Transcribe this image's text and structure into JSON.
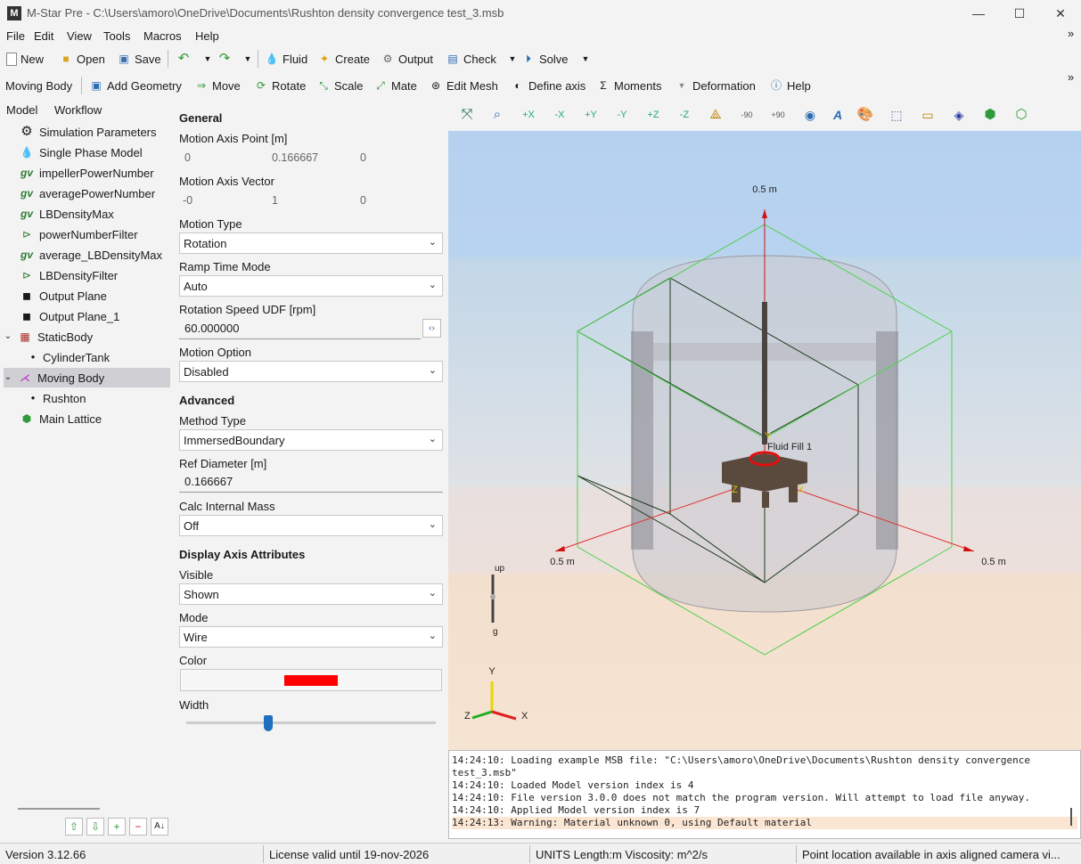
{
  "window": {
    "title": "M-Star Pre - C:\\Users\\amoro\\OneDrive\\Documents\\Rushton density convergence test_3.msb",
    "app_icon": "M"
  },
  "menu": [
    "File",
    "Edit",
    "View",
    "Tools",
    "Macros",
    "Help"
  ],
  "toolbar1": {
    "new": "New",
    "open": "Open",
    "save": "Save",
    "fluid": "Fluid",
    "create": "Create",
    "output": "Output",
    "check": "Check",
    "solve": "Solve"
  },
  "toolbar2": {
    "context": "Moving Body",
    "add_geometry": "Add Geometry",
    "move": "Move",
    "rotate": "Rotate",
    "scale": "Scale",
    "mate": "Mate",
    "edit_mesh": "Edit Mesh",
    "define_axis": "Define axis",
    "moments": "Moments",
    "deformation": "Deformation",
    "help": "Help"
  },
  "left_tabs": {
    "model": "Model",
    "workflow": "Workflow"
  },
  "tree": [
    {
      "label": "Simulation Parameters",
      "icon": "gear-icon"
    },
    {
      "label": "Single Phase Model",
      "icon": "droplet-icon"
    },
    {
      "label": "impellerPowerNumber",
      "icon": "gv-icon"
    },
    {
      "label": "averagePowerNumber",
      "icon": "gv-icon"
    },
    {
      "label": "LBDensityMax",
      "icon": "gv-icon"
    },
    {
      "label": "powerNumberFilter",
      "icon": "filter-icon"
    },
    {
      "label": "average_LBDensityMax",
      "icon": "gv-icon"
    },
    {
      "label": "LBDensityFilter",
      "icon": "filter-icon"
    },
    {
      "label": "Output Plane",
      "icon": "plane-icon"
    },
    {
      "label": "Output Plane_1",
      "icon": "plane-icon"
    },
    {
      "label": "StaticBody",
      "icon": "brick-icon"
    },
    {
      "label": "CylinderTank",
      "icon": "bullet-icon"
    },
    {
      "label": "Moving Body",
      "icon": "moving-body-icon"
    },
    {
      "label": "Rushton",
      "icon": "bullet-icon"
    },
    {
      "label": "Main Lattice",
      "icon": "cube-icon"
    }
  ],
  "props": {
    "general": "General",
    "motion_axis_point_label": "Motion Axis Point [m]",
    "motion_axis_point": [
      "0",
      "0.166667",
      "0"
    ],
    "motion_axis_vector_label": "Motion Axis Vector",
    "motion_axis_vector": [
      "-0",
      "1",
      "0"
    ],
    "motion_type_label": "Motion Type",
    "motion_type": "Rotation",
    "ramp_time_mode_label": "Ramp Time Mode",
    "ramp_time_mode": "Auto",
    "rotation_speed_label": "Rotation Speed UDF [rpm]",
    "rotation_speed": "60.000000",
    "motion_option_label": "Motion Option",
    "motion_option": "Disabled",
    "advanced": "Advanced",
    "method_type_label": "Method Type",
    "method_type": "ImmersedBoundary",
    "ref_diameter_label": "Ref Diameter [m]",
    "ref_diameter": "0.166667",
    "calc_internal_mass_label": "Calc Internal Mass",
    "calc_internal_mass": "Off",
    "display_axis": "Display Axis Attributes",
    "visible_label": "Visible",
    "visible": "Shown",
    "mode_label": "Mode",
    "mode": "Wire",
    "color_label": "Color",
    "color_value": "#ff0000",
    "width_label": "Width",
    "width_fraction": 0.33
  },
  "viewport": {
    "top_label": "0.5 m",
    "left_label": "0.5 m",
    "right_label": "0.5 m",
    "fluid_label": "Fluid Fill 1",
    "up_label": "up",
    "g_label": "g",
    "axis_y": "Y",
    "axis_x": "X",
    "axis_z": "Z",
    "imp_y": "Y",
    "imp_x": "X",
    "imp_z": "Z"
  },
  "console": [
    "14:24:10: Loading example MSB file: \"C:\\Users\\amoro\\OneDrive\\Documents\\Rushton density convergence",
    "test_3.msb\"",
    "14:24:10: Loaded Model version index is 4",
    "14:24:10: File version 3.0.0 does not match the program version. Will attempt to load file anyway.",
    "14:24:10: Applied Model version index is 7",
    "14:24:13: Warning: Material unknown 0, using Default material"
  ],
  "status": {
    "version": "Version 3.12.66",
    "license": "License valid until 19-nov-2026",
    "units": "UNITS Length:m  Viscosity: m^2/s",
    "hint": "Point location available in axis aligned camera vi..."
  },
  "viewtools": {
    "vt_minus90": "-90",
    "vt_plus90": "+90",
    "vt_plus_x": "+X",
    "vt_minus_x": "-X",
    "vt_plus_y": "+Y",
    "vt_minus_y": "-Y",
    "vt_plus_z": "+Z",
    "vt_minus_z": "-Z"
  }
}
